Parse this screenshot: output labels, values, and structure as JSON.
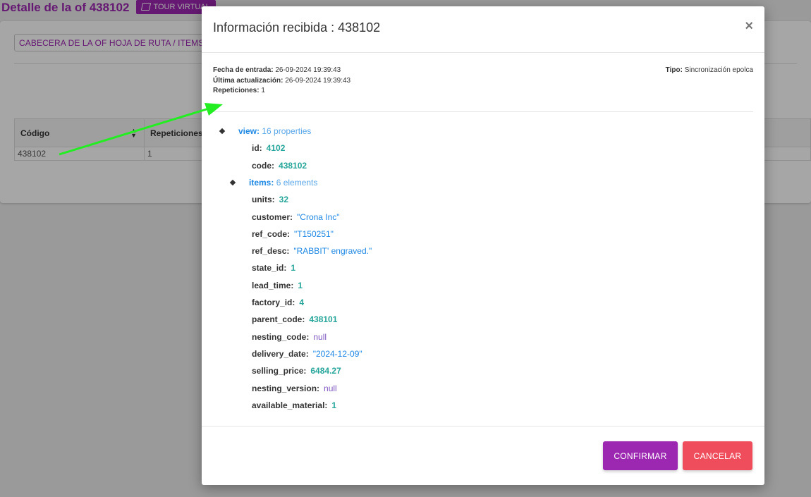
{
  "page": {
    "title": "Detalle de la of 438102",
    "tour_button": "TOUR VIRTUAL",
    "tabs_select": "CABECERA DE LA OF HOJA DE RUTA / ITEMS",
    "table": {
      "headers": [
        "Código",
        "Repeticiones"
      ],
      "row": [
        "438102",
        "1"
      ]
    }
  },
  "modal": {
    "title": "Información recibida :",
    "code": "438102",
    "meta": {
      "entry_label": "Fecha de entrada:",
      "entry_value": "26-09-2024 19:39:43",
      "update_label": "Última actualización:",
      "update_value": "26-09-2024 19:39:43",
      "reps_label": "Repeticiones:",
      "reps_value": "1",
      "type_label": "Tipo:",
      "type_value": "Sincronización epolca"
    },
    "tree": {
      "view_key": "view:",
      "view_meta": "16 properties",
      "id_key": "id:",
      "id_val": "4102",
      "code_key": "code:",
      "code_val": "438102",
      "items_key": "items:",
      "items_meta": "6 elements",
      "units_key": "units:",
      "units_val": "32",
      "customer_key": "customer:",
      "customer_val": "\"Crona Inc\"",
      "ref_code_key": "ref_code:",
      "ref_code_val": "\"T150251\"",
      "ref_desc_key": "ref_desc:",
      "ref_desc_val": "\"RABBIT' engraved.\"",
      "state_id_key": "state_id:",
      "state_id_val": "1",
      "lead_time_key": "lead_time:",
      "lead_time_val": "1",
      "factory_id_key": "factory_id:",
      "factory_id_val": "4",
      "parent_code_key": "parent_code:",
      "parent_code_val": "438101",
      "nesting_code_key": "nesting_code:",
      "nesting_code_val": "null",
      "delivery_date_key": "delivery_date:",
      "delivery_date_val": "\"2024-12-09\"",
      "selling_price_key": "selling_price:",
      "selling_price_val": "6484.27",
      "nesting_version_key": "nesting_version:",
      "nesting_version_val": "null",
      "available_material_key": "available_material:",
      "available_material_val": "1"
    },
    "confirm_label": "CONFIRMAR",
    "cancel_label": "CANCELAR"
  },
  "colors": {
    "brand": "#9c27b0",
    "danger": "#ef4d5c",
    "arrow": "#22ee22"
  },
  "icons": [
    "book-icon",
    "sort-icon",
    "close-icon",
    "collapse-diamond-icon"
  ]
}
